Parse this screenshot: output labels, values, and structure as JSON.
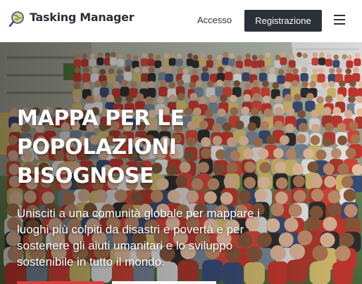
{
  "header": {
    "app_title": "Tasking Manager",
    "login_label": "Accesso",
    "register_label": "Registrazione",
    "menu_icon": "hamburger-menu-icon",
    "logo_icon": "globe-magnifier-logo-icon"
  },
  "hero": {
    "title_lines": [
      "MAPPA PER LE",
      "POPOLAZIONI",
      "BISOGNOSE"
    ],
    "text_lines": [
      "Unisciti a una comunità globale per mappare i",
      "luoghi più colpiti da disastri e povertà e per",
      "sostenere gli aiuti umanitari e lo sviluppo",
      "sostenibile in tutto il mondo."
    ],
    "image": "crowd-group-photo"
  },
  "colors": {
    "primary_dark": "#2c3038",
    "accent_red": "#d73f3f",
    "white": "#ffffff"
  }
}
